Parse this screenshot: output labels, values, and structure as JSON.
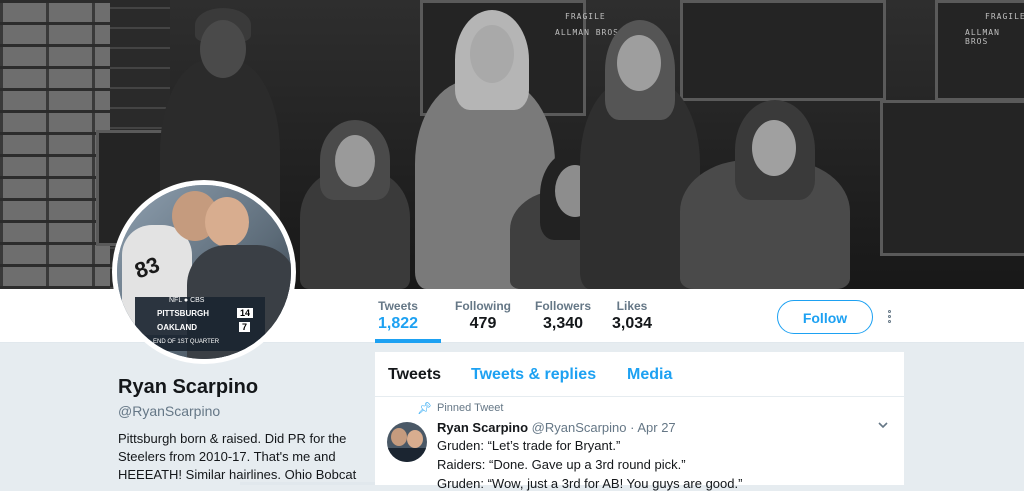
{
  "header": {
    "crate_labels": [
      "FRAGILE",
      "ALLMAN BROS",
      "FRAGILE",
      "ALLMAN BROS",
      "FRAGILE",
      "ALLMAN BROS"
    ]
  },
  "avatar_overlay": {
    "network": "NFL ● CBS",
    "team1": "PITTSBURGH",
    "score1": "14",
    "team2": "OAKLAND",
    "score2": "7",
    "period": "END OF 1ST QUARTER",
    "jersey": "83"
  },
  "nav": {
    "tweets_label": "Tweets",
    "tweets_value": "1,822",
    "following_label": "Following",
    "following_value": "479",
    "followers_label": "Followers",
    "followers_value": "3,340",
    "likes_label": "Likes",
    "likes_value": "3,034"
  },
  "follow_button": "Follow",
  "profile": {
    "name": "Ryan Scarpino",
    "handle": "@RyanScarpino",
    "bio_lines": [
      "Pittsburgh born & raised. Did PR for the",
      "Steelers from 2010-17. That's me and",
      "HEEEATH! Similar hairlines. Ohio Bobcat"
    ]
  },
  "timeline": {
    "tabs": [
      "Tweets",
      "Tweets & replies",
      "Media"
    ],
    "pinned_label": "Pinned Tweet",
    "tweet": {
      "name": "Ryan Scarpino",
      "handle": "@RyanScarpino",
      "date": "· Apr 27",
      "lines": [
        "Gruden: “Let’s trade for Bryant.”",
        "Raiders: “Done. Gave up a 3rd round pick.”",
        "Gruden: “Wow, just a 3rd for AB! You guys are good.”"
      ]
    }
  },
  "colors": {
    "accent": "#1da1f2",
    "text": "#14171a",
    "muted": "#657786",
    "background": "#e6ecf0"
  }
}
